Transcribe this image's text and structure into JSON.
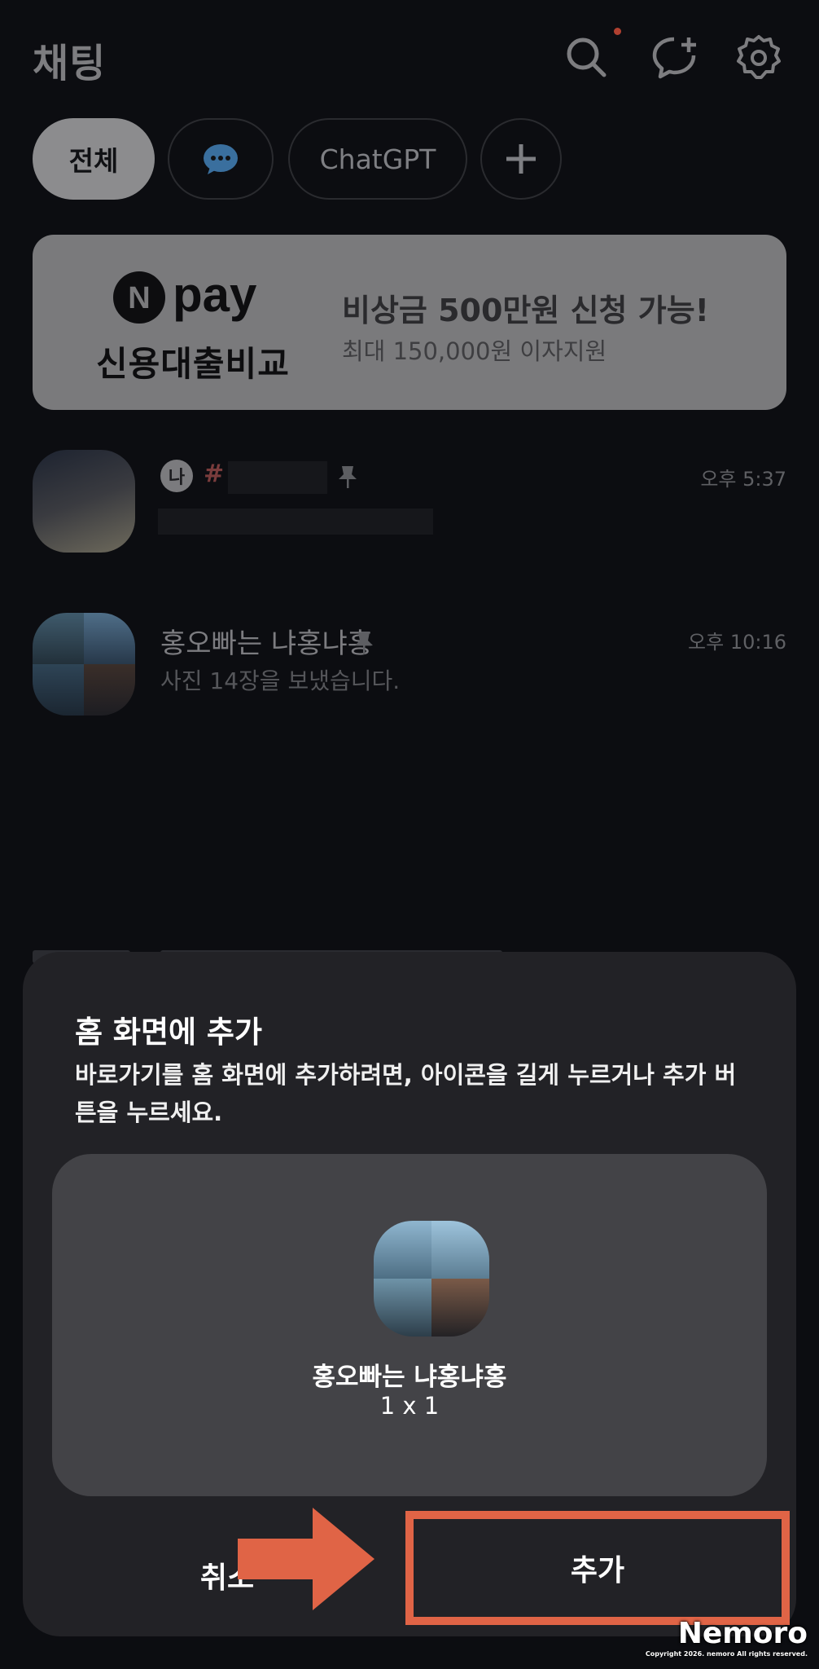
{
  "header": {
    "title": "채팅",
    "icons": [
      "search-icon",
      "new-chat-icon",
      "settings-icon"
    ],
    "notification_color": "#b04030"
  },
  "filter_chips": [
    {
      "label": "전체",
      "active": true
    },
    {
      "label": "",
      "icon": "chat-bubble-icon"
    },
    {
      "label": "ChatGPT"
    },
    {
      "label": "",
      "icon": "plus-icon"
    }
  ],
  "banner": {
    "logo_text": "pay",
    "logo_badge": "N",
    "subtitle": "신용대출비교",
    "title": "비상금 500만원 신청 가능!",
    "description": "최대 150,000원 이자지원"
  },
  "chats": [
    {
      "badge": "나",
      "hash": "#",
      "name": "",
      "message": "",
      "time": "오후 5:37",
      "pinned": true
    },
    {
      "name": "홍오빠는 냐홍냐홍",
      "message": "사진 14장을 보냈습니다.",
      "time": "오후 10:16",
      "pinned": true
    }
  ],
  "sheet": {
    "title": "홈 화면에 추가",
    "description": "바로가기를 홈 화면에 추가하려면, 아이콘을 길게 누르거나 추가 버튼을 누르세요.",
    "preview": {
      "name": "홍오빠는 냐홍냐홍",
      "size": "1 x 1"
    },
    "cancel_label": "취소",
    "add_label": "추가",
    "highlight_color": "#e06446"
  },
  "watermark": {
    "brand": "Nemoro",
    "copyright": "Copyright 2026. nemoro All rights reserved."
  }
}
